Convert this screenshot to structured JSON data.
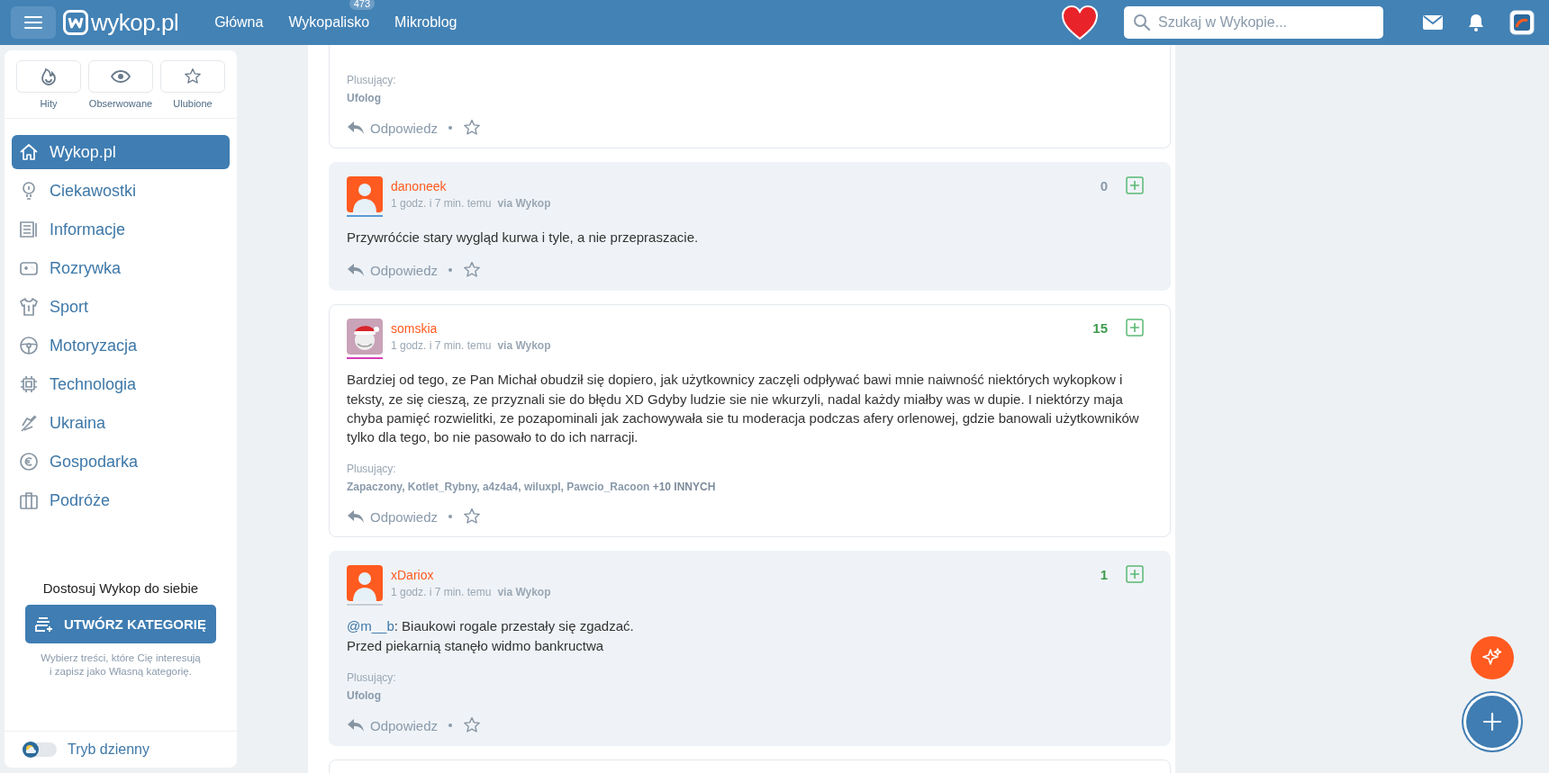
{
  "header": {
    "logo": "wykop.pl",
    "nav": [
      {
        "label": "Główna"
      },
      {
        "label": "Wykopalisko",
        "badge": "473"
      },
      {
        "label": "Mikroblog"
      }
    ],
    "search": {
      "placeholder": "Szukaj w Wykopie..."
    }
  },
  "sidebar": {
    "shortcuts": [
      {
        "label": "Hity"
      },
      {
        "label": "Obserwowane"
      },
      {
        "label": "Ulubione"
      }
    ],
    "categories": [
      {
        "label": "Wykop.pl",
        "selected": true
      },
      {
        "label": "Ciekawostki",
        "selected": false
      },
      {
        "label": "Informacje",
        "selected": false
      },
      {
        "label": "Rozrywka",
        "selected": false
      },
      {
        "label": "Sport",
        "selected": false
      },
      {
        "label": "Motoryzacja",
        "selected": false
      },
      {
        "label": "Technologia",
        "selected": false
      },
      {
        "label": "Ukraina",
        "selected": false
      },
      {
        "label": "Gospodarka",
        "selected": false
      },
      {
        "label": "Podróże",
        "selected": false
      }
    ],
    "promo": {
      "title": "Dostosuj Wykop do siebie",
      "button": "UTWÓRZ KATEGORIĘ",
      "hint": "Wybierz treści, które Cię interesują\ni zapisz jako Własną kategorię."
    },
    "theme_toggle": {
      "label": "Tryb dzienny",
      "on": false
    }
  },
  "comments": [
    {
      "kind": "cut",
      "highlighted": false,
      "voters_label": "Plusujący:",
      "voters": "Ufolog",
      "reply": "Odpowiedz",
      "favorited": false
    },
    {
      "kind": "full",
      "highlighted": true,
      "author": "danoneek",
      "custom_avatar": false,
      "color": "#5b9bd5",
      "time": "1 godz. i 7 min. temu",
      "via": "via Wykop",
      "votes": "0",
      "text": "Przywróćcie stary wygląd kurwa i tyle, a nie przepraszacie.",
      "reply": "Odpowiedz",
      "favorited": false
    },
    {
      "kind": "full",
      "highlighted": false,
      "author": "somskia",
      "custom_avatar": true,
      "color": "#d63fb5",
      "time": "1 godz. i 7 min. temu",
      "via": "via Wykop",
      "votes": "15",
      "text": "Bardziej od tego, ze Pan Michał obudził się dopiero, jak użytkownicy zaczęli odpływać bawi mnie naiwność niektórych wykopkow i teksty, ze się cieszą, ze przyznali sie do błędu XD Gdyby ludzie sie nie wkurzyli, nadal każdy miałby was w dupie. I niektórzy maja chyba pamięć rozwielitki, ze pozapominali jak zachowywała sie tu moderacja podczas afery orlenowej, gdzie banowali użytkowników tylko dla tego, bo nie pasowało to do ich narracji.",
      "voters_label": "Plusujący:",
      "voters": "Zapaczony, Kotlet_Rybny, a4z4a4, wiluxpl, Pawcio_Racoon **+10 INNYCH**",
      "reply": "Odpowiedz",
      "favorited": false
    },
    {
      "kind": "full",
      "highlighted": true,
      "author": "xDariox",
      "custom_avatar": false,
      "color": "#c7ced6",
      "time": "1 godz. i 7 min. temu",
      "via": "via Wykop",
      "votes": "1",
      "mention": "@m__b",
      "text": ": Biaukowi rogale przestały się zgadzać.\nPrzed piekarnią stanęło widmo bankructwa",
      "voters_label": "Plusujący:",
      "voters": "Ufolog",
      "reply": "Odpowiedz",
      "favorited": false
    }
  ]
}
